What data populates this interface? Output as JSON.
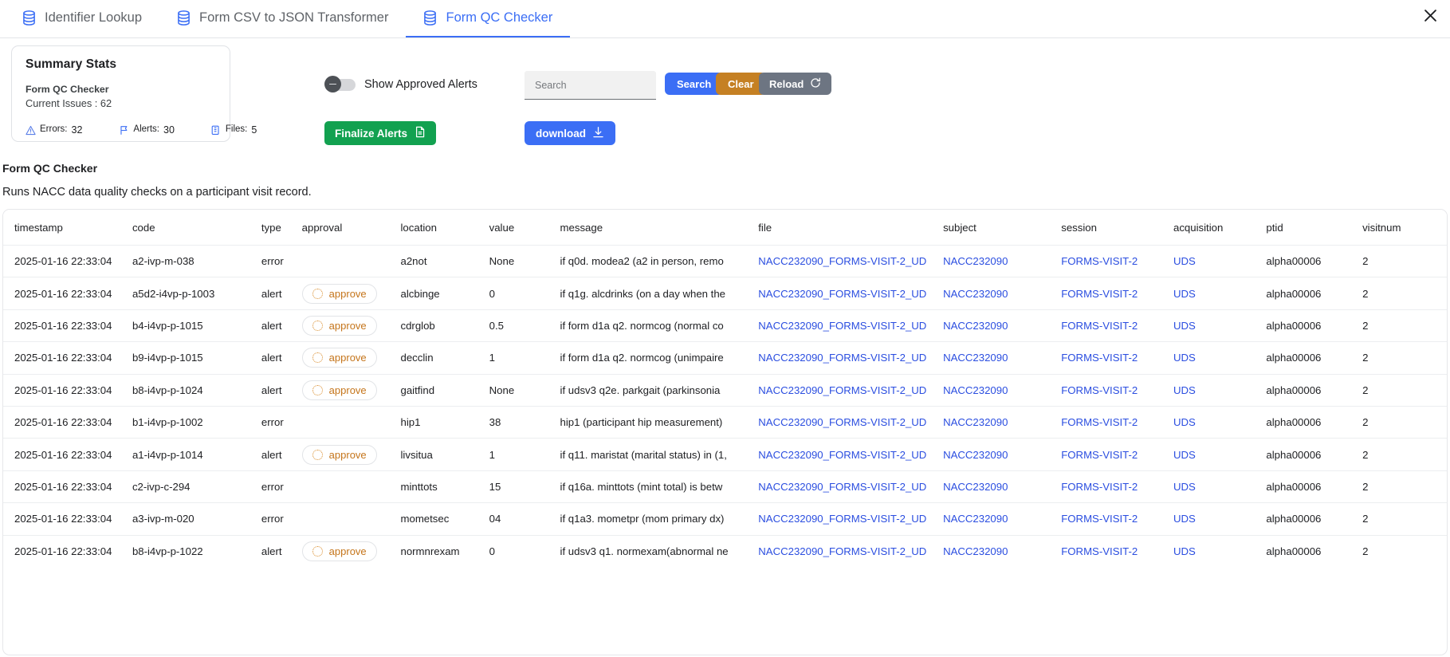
{
  "tabs": [
    {
      "label": "Identifier Lookup",
      "icon": "database-icon",
      "active": false
    },
    {
      "label": "Form CSV to JSON Transformer",
      "icon": "database-icon",
      "active": false
    },
    {
      "label": "Form QC Checker",
      "icon": "database-icon",
      "active": true
    }
  ],
  "window": {
    "close_label": "close-icon"
  },
  "summary": {
    "title": "Summary Stats",
    "subtitle": "Form QC Checker",
    "issues_label": "Current Issues : 62",
    "stats": [
      {
        "icon": "warning-triangle-icon",
        "label": "Errors:",
        "value": "32"
      },
      {
        "icon": "flag-icon",
        "label": "Alerts:",
        "value": "30"
      },
      {
        "icon": "files-icon",
        "label": "Files:",
        "value": "5"
      }
    ]
  },
  "controls": {
    "toggle_label": "Show Approved Alerts",
    "toggle_state": "off",
    "finalize_label": "Finalize Alerts",
    "finalize_icon": "document-icon",
    "search_placeholder": "Search",
    "search_value": "",
    "search_button": "Search",
    "clear_button": "Clear",
    "reload_button": "Reload",
    "reload_icon": "refresh-icon",
    "download_button": "download",
    "download_icon": "download-arrow-icon"
  },
  "section": {
    "title": "Form QC Checker",
    "description": "Runs NACC data quality checks on a participant visit record."
  },
  "table": {
    "columns": [
      "timestamp",
      "code",
      "type",
      "approval",
      "location",
      "value",
      "message",
      "file",
      "subject",
      "session",
      "acquisition",
      "ptid",
      "visitnum"
    ],
    "approve_label": "approve",
    "rows": [
      {
        "timestamp": "2025-01-16 22:33:04",
        "code": "a2-ivp-m-038",
        "type": "error",
        "approval": "",
        "location": "a2not",
        "value": "None",
        "message": "if q0d. modea2 (a2 in person, remo",
        "file": "NACC232090_FORMS-VISIT-2_UD",
        "subject": "NACC232090",
        "session": "FORMS-VISIT-2",
        "acquisition": "UDS",
        "ptid": "alpha00006",
        "visitnum": "2"
      },
      {
        "timestamp": "2025-01-16 22:33:04",
        "code": "a5d2-i4vp-p-1003",
        "type": "alert",
        "approval": "approve",
        "location": "alcbinge",
        "value": "0",
        "message": "if q1g. alcdrinks (on a day when the",
        "file": "NACC232090_FORMS-VISIT-2_UD",
        "subject": "NACC232090",
        "session": "FORMS-VISIT-2",
        "acquisition": "UDS",
        "ptid": "alpha00006",
        "visitnum": "2"
      },
      {
        "timestamp": "2025-01-16 22:33:04",
        "code": "b4-i4vp-p-1015",
        "type": "alert",
        "approval": "approve",
        "location": "cdrglob",
        "value": "0.5",
        "message": "if form d1a q2. normcog (normal co",
        "file": "NACC232090_FORMS-VISIT-2_UD",
        "subject": "NACC232090",
        "session": "FORMS-VISIT-2",
        "acquisition": "UDS",
        "ptid": "alpha00006",
        "visitnum": "2"
      },
      {
        "timestamp": "2025-01-16 22:33:04",
        "code": "b9-i4vp-p-1015",
        "type": "alert",
        "approval": "approve",
        "location": "decclin",
        "value": "1",
        "message": "if form d1a q2. normcog (unimpaire",
        "file": "NACC232090_FORMS-VISIT-2_UD",
        "subject": "NACC232090",
        "session": "FORMS-VISIT-2",
        "acquisition": "UDS",
        "ptid": "alpha00006",
        "visitnum": "2"
      },
      {
        "timestamp": "2025-01-16 22:33:04",
        "code": "b8-i4vp-p-1024",
        "type": "alert",
        "approval": "approve",
        "location": "gaitfind",
        "value": "None",
        "message": "if udsv3 q2e. parkgait (parkinsonia",
        "file": "NACC232090_FORMS-VISIT-2_UD",
        "subject": "NACC232090",
        "session": "FORMS-VISIT-2",
        "acquisition": "UDS",
        "ptid": "alpha00006",
        "visitnum": "2"
      },
      {
        "timestamp": "2025-01-16 22:33:04",
        "code": "b1-i4vp-p-1002",
        "type": "error",
        "approval": "",
        "location": "hip1",
        "value": "38",
        "message": "hip1 (participant hip measurement)",
        "file": "NACC232090_FORMS-VISIT-2_UD",
        "subject": "NACC232090",
        "session": "FORMS-VISIT-2",
        "acquisition": "UDS",
        "ptid": "alpha00006",
        "visitnum": "2"
      },
      {
        "timestamp": "2025-01-16 22:33:04",
        "code": "a1-i4vp-p-1014",
        "type": "alert",
        "approval": "approve",
        "location": "livsitua",
        "value": "1",
        "message": "if q11. maristat (marital status) in (1,",
        "file": "NACC232090_FORMS-VISIT-2_UD",
        "subject": "NACC232090",
        "session": "FORMS-VISIT-2",
        "acquisition": "UDS",
        "ptid": "alpha00006",
        "visitnum": "2"
      },
      {
        "timestamp": "2025-01-16 22:33:04",
        "code": "c2-ivp-c-294",
        "type": "error",
        "approval": "",
        "location": "minttots",
        "value": "15",
        "message": "if q16a. minttots (mint total) is betw",
        "file": "NACC232090_FORMS-VISIT-2_UD",
        "subject": "NACC232090",
        "session": "FORMS-VISIT-2",
        "acquisition": "UDS",
        "ptid": "alpha00006",
        "visitnum": "2"
      },
      {
        "timestamp": "2025-01-16 22:33:04",
        "code": "a3-ivp-m-020",
        "type": "error",
        "approval": "",
        "location": "mometsec",
        "value": "04",
        "message": "if q1a3. mometpr (mom primary dx)",
        "file": "NACC232090_FORMS-VISIT-2_UD",
        "subject": "NACC232090",
        "session": "FORMS-VISIT-2",
        "acquisition": "UDS",
        "ptid": "alpha00006",
        "visitnum": "2"
      },
      {
        "timestamp": "2025-01-16 22:33:04",
        "code": "b8-i4vp-p-1022",
        "type": "alert",
        "approval": "approve",
        "location": "normnrexam",
        "value": "0",
        "message": "if udsv3 q1. normexam(abnormal ne",
        "file": "NACC232090_FORMS-VISIT-2_UD",
        "subject": "NACC232090",
        "session": "FORMS-VISIT-2",
        "acquisition": "UDS",
        "ptid": "alpha00006",
        "visitnum": "2"
      }
    ]
  },
  "colors": {
    "accent_blue": "#3b6ef5",
    "link_blue": "#2b4ee0",
    "green": "#12a150",
    "orange": "#c58023",
    "slate": "#6d7582",
    "approve_orange": "#c5751b"
  }
}
